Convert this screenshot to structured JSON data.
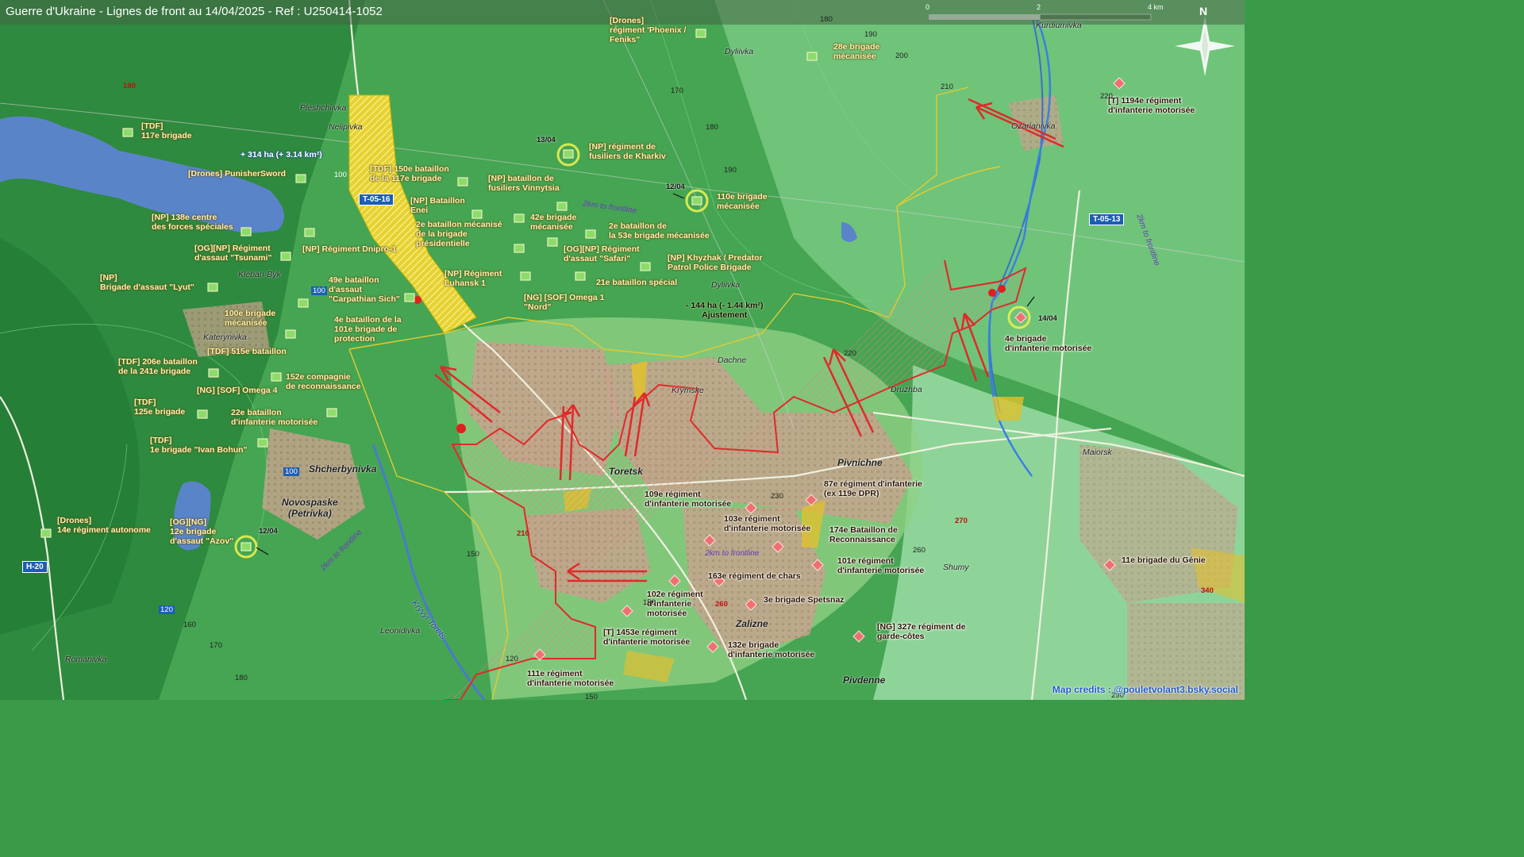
{
  "title": "Guerre d'Ukraine - Lignes de front au 14/04/2025 - Ref : U250414-1052",
  "scale": {
    "labels": [
      "0",
      "2",
      "4 km"
    ]
  },
  "north_label": "N",
  "credits": "Map credits : @pouletvolant3.bsky.social",
  "ukr_units": [
    "[Drones]\nrégiment 'Phoenix /\nFeniks\"",
    "28e brigade\nmécanisée",
    "[TDF]\n117e brigade",
    "[NP] régiment de\nfusiliers de Kharkiv",
    "[TDF] 150e bataillon\nde la 117e brigade",
    "[Drones] PunisherSword",
    "[NP] bataillon de\nfusiliers Vinnytsia",
    "110e brigade\nmécanisée",
    "[NP] Bataillon\nEnei",
    "42e brigade\nmécanisée",
    "[NP] 138e centre\ndes forces spéciales",
    "2e bataillon mécanisé\nde la brigade\nprésidentielle",
    "2e bataillon de\nla 53e brigade mécanisée",
    "[OG][NP] Régiment\nd'assaut \"Tsunami\"",
    "[NP] Régiment Dnipro-1",
    "[OG][NP] Régiment\nd'assaut \"Safari\"",
    "[NP] Khyzhak / Predator\nPatrol Police Brigade",
    "[NP]\nBrigade d'assaut \"Lyut\"",
    "49e bataillon\nd'assaut\n\"Carpathian Sich\"",
    "[NP] Régiment\nLuhansk 1",
    "21e bataillon spécial",
    "[NG] [SOF] Omega 1\n\"Nord\"",
    "100e brigade\nmécanisée",
    "4e bataillon de la\n101e brigade de\nprotection",
    "[TDF] 515e bataillon",
    "[TDF] 206e bataillon\nde la 241e brigade",
    "152e compagnie\nde reconnaissance",
    "[NG] [SOF] Omega 4",
    "[TDF]\n125e brigade",
    "22e bataillon\nd'infanterie motorisée",
    "[TDF]\n1e brigade \"Ivan Bohun\"",
    "[Drones]\n14e régiment autonome",
    "[OG][NG]\n12e brigade\nd'assaut \"Azov\""
  ],
  "ru_units": [
    "[T] 1194e régiment\nd'infanterie motorisée",
    "4e brigade\nd'infanterie motorisée",
    "109e régiment\nd'infanterie motorisée",
    "87e régiment d'infanterie\n(ex 119e DPR)",
    "103e régiment\nd'infanterie motorisée",
    "174e Bataillon de\nReconnaissance",
    "101e régiment\nd'infanterie motorisée",
    "163e régiment de chars",
    "102e régiment\nd'infanterie\nmotorisée",
    "3e brigade Spetsnaz",
    "11e brigade du Génie",
    "[T] 1453e régiment\nd'infanterie motorisée",
    "[NG] 327e régiment de\ngarde-côtes",
    "132e brigade\nd'infanterie motorisée",
    "111e régiment\nd'infanterie motorisée"
  ],
  "towns": [
    "Kurdiumivka",
    "Dyliivka",
    "Pleshchiivka",
    "Nelipivka",
    "Ozarianivka",
    "Kleban-Byk",
    "Dyliivka",
    "Katerynivka",
    "Dachne",
    "Krymske",
    "Druzhba",
    "Shcherbynivka",
    "Toretsk",
    "Pivnichne",
    "Maiorsk",
    "Novospaske\n(Petrivka)",
    "Shumy",
    "Zalizne",
    "Leonidivka",
    "Romanivka",
    "Pivdenne",
    "Kryvyi Torets"
  ],
  "elevations": [
    "180",
    "190",
    "180",
    "200",
    "170",
    "180",
    "190",
    "210",
    "220",
    "100",
    "100",
    "100",
    "220",
    "230",
    "210",
    "150",
    "260",
    "270",
    "260",
    "340",
    "120",
    "160",
    "170",
    "180",
    "150",
    "120",
    "150",
    "290"
  ],
  "roads": [
    "T-05-16",
    "T-05-13",
    "H-20"
  ],
  "dates": [
    "13/04",
    "12/04",
    "14/04",
    "12/04"
  ],
  "notes": [
    "2km to frontline",
    "2km to frontline",
    "2km to frontline",
    "2km to frontline"
  ],
  "area_changes": [
    "+ 314 ha (+ 3.14 km²)",
    "- 144 ha (- 1.44 km²)\nAjustement"
  ]
}
